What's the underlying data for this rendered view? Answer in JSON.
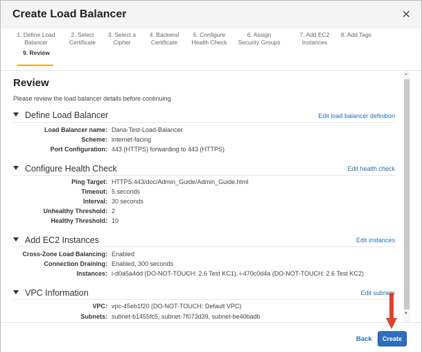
{
  "dialog": {
    "title": "Create Load Balancer"
  },
  "steps": [
    {
      "label": "1. Define Load Balancer"
    },
    {
      "label": "2. Select Certificate"
    },
    {
      "label": "3. Select a Cipher"
    },
    {
      "label": "4. Backend Certificate"
    },
    {
      "label": "5. Configure Health Check"
    },
    {
      "label": "6. Assign Security Groups"
    },
    {
      "label": "7. Add EC2 Instances"
    },
    {
      "label": "8. Add Tags"
    },
    {
      "label": "9. Review"
    }
  ],
  "review": {
    "heading": "Review",
    "intro": "Please review the load balancer details before continuing"
  },
  "sections": {
    "define": {
      "title": "Define Load Balancer",
      "edit": "Edit load balancer definition",
      "rows": [
        {
          "label": "Load Balancer name:",
          "value": "Dana-Test-Load-Balancer"
        },
        {
          "label": "Scheme:",
          "value": "internet-facing"
        },
        {
          "label": "Port Configuration:",
          "value": "443 (HTTPS) forwarding to 443 (HTTPS)"
        }
      ]
    },
    "health": {
      "title": "Configure Health Check",
      "edit": "Edit health check",
      "rows": [
        {
          "label": "Ping Target:",
          "value": "HTTPS:443/doc/Admin_Guide/Admin_Guide.html"
        },
        {
          "label": "Timeout:",
          "value": "5 seconds"
        },
        {
          "label": "Interval:",
          "value": "30 seconds"
        },
        {
          "label": "Unhealthy Threshold:",
          "value": "2"
        },
        {
          "label": "Healthy Threshold:",
          "value": "10"
        }
      ]
    },
    "ec2": {
      "title": "Add EC2 Instances",
      "edit": "Edit instances",
      "rows": [
        {
          "label": "Cross-Zone Load Balancing:",
          "value": "Enabled"
        },
        {
          "label": "Connection Draining:",
          "value": "Enabled, 300 seconds"
        },
        {
          "label": "Instances:",
          "value": "i-d0a5a4dd (DO-NOT-TOUCH: 2.6 Test KC1), i-470c0d4a (DO-NOT-TOUCH: 2.6 Test KC2)"
        }
      ]
    },
    "vpc": {
      "title": "VPC Information",
      "edit": "Edit subnets",
      "rows": [
        {
          "label": "VPC:",
          "value": "vpc-45eb1f20 (DO-NOT-TOUCH: Default VPC)"
        },
        {
          "label": "Subnets:",
          "value": "subnet-b1455fc5, subnet-7f073d39, subnet-be40badb"
        }
      ]
    }
  },
  "footer": {
    "back": "Back",
    "create": "Create"
  },
  "colors": {
    "primary": "#2d6ec1",
    "link": "#1f6fb5",
    "active_step": "#f0a336",
    "arrow": "#e0412a"
  },
  "icons": {
    "close": "close-icon",
    "collapse": "triangle-down-icon",
    "pointer": "arrow-down-icon"
  }
}
